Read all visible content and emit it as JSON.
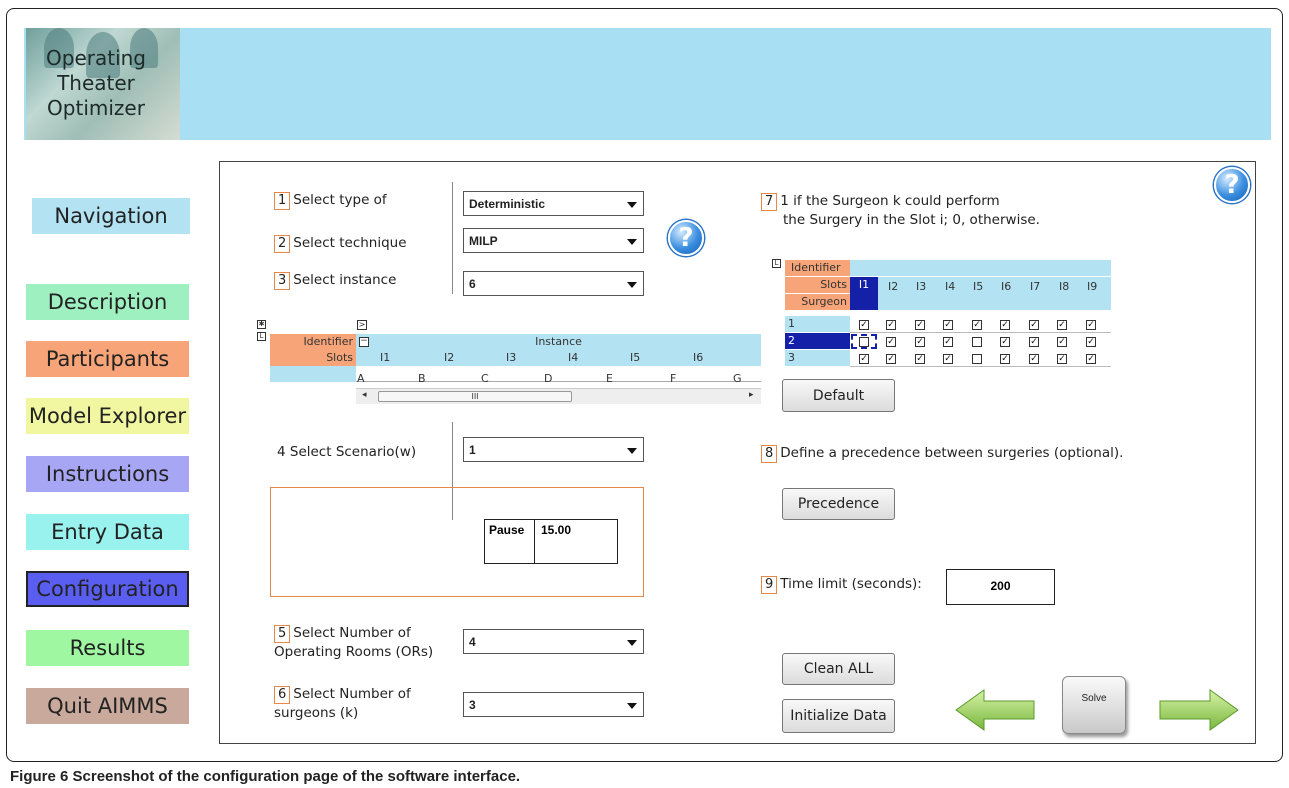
{
  "app": {
    "logo_lines": [
      "Operating",
      "Theater",
      "Optimizer"
    ]
  },
  "nav": [
    {
      "label": "Navigation",
      "color": "#b3e3f3"
    },
    {
      "label": "Description",
      "color": "#9ff0c1"
    },
    {
      "label": "Participants",
      "color": "#f7a578"
    },
    {
      "label": "Model Explorer",
      "color": "#f0f7a0"
    },
    {
      "label": "Instructions",
      "color": "#a7a6f5"
    },
    {
      "label": "Entry Data",
      "color": "#9af2ef"
    },
    {
      "label": "Configuration",
      "color": "#5a5ef0"
    },
    {
      "label": "Results",
      "color": "#9ff7a1"
    },
    {
      "label": "Quit AIMMS",
      "color": "#c9a99b"
    }
  ],
  "config": {
    "step1": {
      "num": "1",
      "label": "Select type of",
      "value": "Deterministic"
    },
    "step2": {
      "num": "2",
      "label": "Select technique",
      "value": "MILP"
    },
    "step3": {
      "num": "3",
      "label": "Select instance",
      "value": "6"
    },
    "step4": {
      "label": "4  Select Scenario(w)",
      "value": "1"
    },
    "step5": {
      "num": "5",
      "label_line1": "Select Number of",
      "label_line2": "Operating Rooms (ORs)",
      "value": "4"
    },
    "step6": {
      "num": "6",
      "label_line1": "Select Number of",
      "label_line2": "surgeons (k)",
      "value": "3"
    },
    "pause": {
      "label": "Pause",
      "value": "15.00"
    }
  },
  "instance_table": {
    "identifier": "Identifier",
    "slots": "Slots",
    "instance": "Instance",
    "collapse": "−",
    "columns": [
      "I1",
      "I2",
      "I3",
      "I4",
      "I5",
      "I6"
    ],
    "values": [
      "A",
      "B",
      "C",
      "D",
      "E",
      "F",
      "G"
    ],
    "scroll_mark": "III"
  },
  "step7": {
    "num": "7",
    "line1": "1 if the Surgeon k could perform",
    "line2": "the Surgery in the Slot i; 0, otherwise.",
    "identifier": "Identifier",
    "slots": "Slots",
    "surgeon": "Surgeon",
    "columns": [
      "I1",
      "I2",
      "I3",
      "I4",
      "I5",
      "I6",
      "I7",
      "I8",
      "I9"
    ],
    "rows": [
      {
        "label": "1",
        "checks": [
          true,
          true,
          true,
          true,
          true,
          true,
          true,
          true,
          true
        ]
      },
      {
        "label": "2",
        "checks": [
          false,
          true,
          true,
          true,
          false,
          true,
          true,
          true,
          true
        ]
      },
      {
        "label": "3",
        "checks": [
          true,
          true,
          true,
          true,
          false,
          true,
          true,
          true,
          true
        ]
      }
    ],
    "default_label": "Default"
  },
  "step8": {
    "num": "8",
    "label": "Define a precedence between surgeries (optional).",
    "button": "Precedence"
  },
  "step9": {
    "num": "9",
    "label": "Time limit (seconds):",
    "value": "200"
  },
  "actions": {
    "clean": "Clean ALL",
    "initialize": "Initialize Data",
    "solve": "Solve"
  },
  "icons": {
    "help": "?",
    "check": "✓"
  },
  "caption": {
    "bold": "Figure 6 Screenshot of the configuration page of the software interface."
  }
}
